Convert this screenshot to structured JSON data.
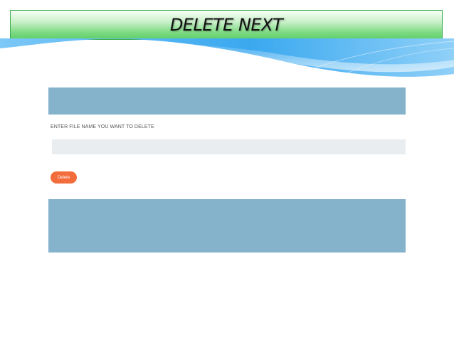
{
  "page": {
    "title": "DELETE NEXT"
  },
  "form": {
    "label": "ENTER FILE NAME YOU WANT TO DELETE",
    "input_value": "",
    "input_placeholder": "",
    "delete_label": "Delete"
  },
  "colors": {
    "band": "#85b3cc",
    "button": "#f36c3c",
    "banner": "#5fcf6a",
    "wave": "#3aa8ef"
  }
}
